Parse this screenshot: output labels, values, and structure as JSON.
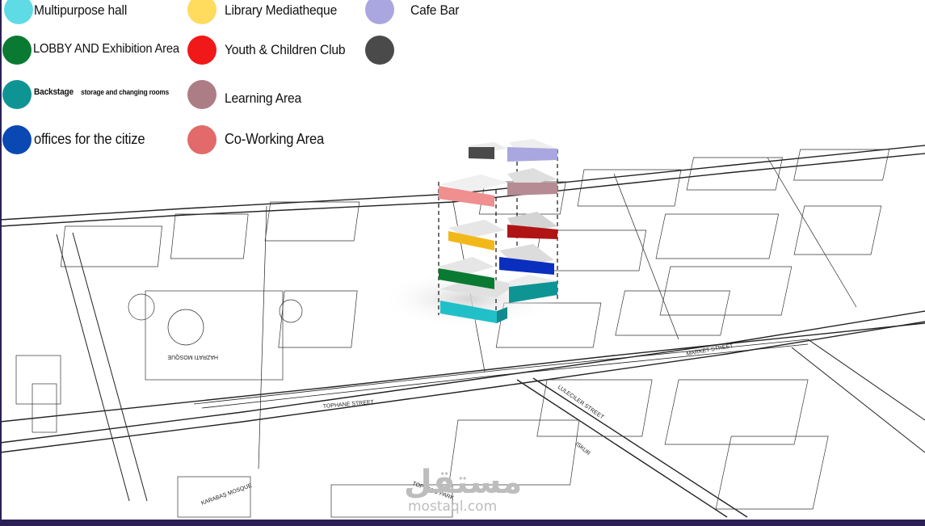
{
  "legend": {
    "multipurpose_hall": {
      "label": "Multipurpose hall",
      "color": "#5fdbe6"
    },
    "lobby": {
      "label": "LOBBY AND Exhibition Area",
      "color": "#0a7a32"
    },
    "backstage": {
      "label": "Backstage",
      "sublabel": "storage and changing rooms",
      "color": "#0f9494"
    },
    "offices": {
      "label": "offices for the citize",
      "color": "#0a48b4"
    },
    "library": {
      "label": "Library Mediatheque",
      "color": "#ffdb5e"
    },
    "youth": {
      "label": "Youth & Children Club",
      "color": "#f01818"
    },
    "learning": {
      "label": "Learning Area",
      "color": "#ad7d86"
    },
    "coworking": {
      "label": "Co-Working Area",
      "color": "#e26a6a"
    },
    "cafe": {
      "label": "Cafe Bar",
      "color": "#a9a6e0"
    },
    "unlabeled_dark": {
      "label": "",
      "color": "#4a4a4a"
    }
  },
  "map_labels": {
    "mosque_1": "KARABAŞ MOSQUE",
    "mosque_2": "HAZRATI MOSQUE",
    "street_1": "TOPHANE PARK",
    "street_2": "ISKUR",
    "street_3": "LULECILER STREET",
    "street_4": "TOPHANE STREET",
    "street_5": "MARKET STREET"
  },
  "watermark": {
    "arabic": "مستقل",
    "latin": "mostaql.com"
  }
}
